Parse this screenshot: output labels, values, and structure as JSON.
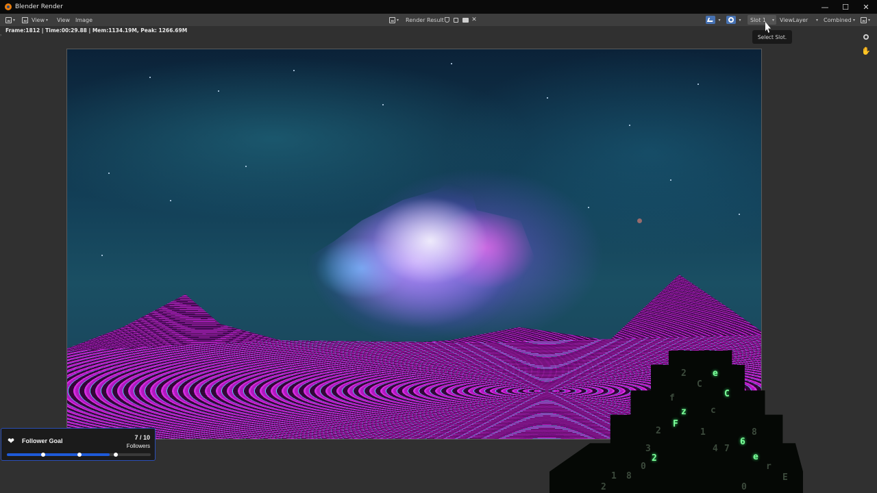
{
  "window": {
    "title": "Blender Render",
    "logo_icon": "blender-logo-icon",
    "controls": [
      "minimize-icon",
      "maximize-icon",
      "close-icon"
    ],
    "control_glyphs": [
      "—",
      "☐",
      "✕"
    ]
  },
  "header": {
    "menu": {
      "view_dropdown": "View",
      "view": "View",
      "image": "Image"
    },
    "image_selector": {
      "name": "Render Result",
      "icons": [
        "shield-icon",
        "duplicate-icon",
        "folder-icon",
        "unlink-icon"
      ]
    },
    "slot": {
      "label": "Slot 1"
    },
    "view_layer": {
      "label": "ViewLayer"
    },
    "pass": {
      "label": "Combined"
    }
  },
  "status": {
    "text": "Frame:1812 | Time:00:29.88 | Mem:1134.19M, Peak: 1266.69M"
  },
  "tooltip": {
    "text": "Select Slot."
  },
  "navigation": [
    "zoom-icon",
    "pan-hand-icon"
  ],
  "follower_goal": {
    "title": "Follower Goal",
    "count": "7 / 10",
    "unit": "Followers",
    "current": 7,
    "target": 10,
    "progress": 0.7,
    "bar_color": "#1e5ad8",
    "border_color": "#2b4fb8"
  },
  "overlay_glyphs": [
    "2",
    "e",
    "C",
    "z",
    "f",
    "C",
    "c",
    "2",
    "F",
    "8",
    "1",
    "6",
    "3",
    "4",
    "7",
    "2",
    "e",
    "0",
    "r",
    "1",
    "8",
    "E",
    "2",
    "0"
  ],
  "colors": {
    "accent": "#4772b3",
    "header_bg": "#3d3d3d",
    "editor_bg": "#303030",
    "titlebar_bg": "#0a0a0a"
  }
}
